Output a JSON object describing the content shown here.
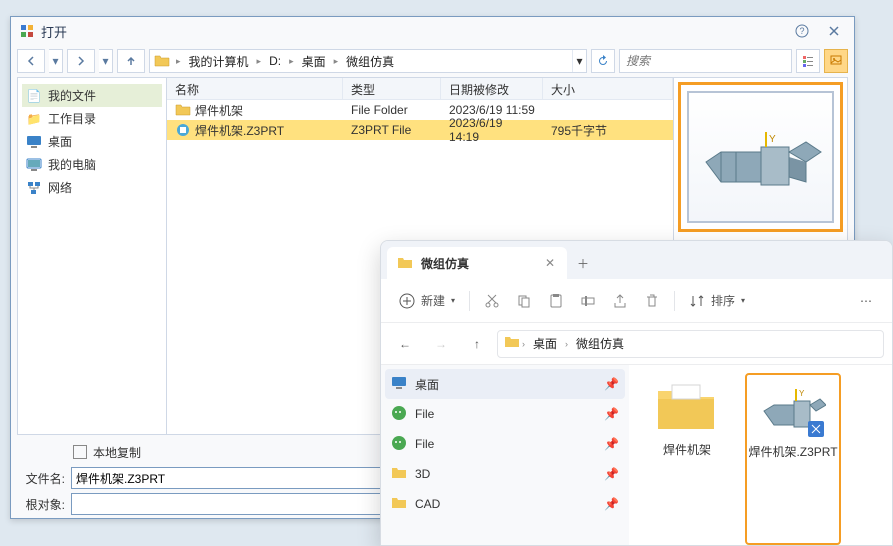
{
  "dialog": {
    "title": "打开",
    "breadcrumb": [
      "我的计算机",
      "D:",
      "桌面",
      "微组仿真"
    ],
    "search_placeholder": "搜索",
    "tree": [
      {
        "label": "我的文件",
        "icon": "file-icon"
      },
      {
        "label": "工作目录",
        "icon": "folder-link-icon"
      },
      {
        "label": "桌面",
        "icon": "desktop-icon"
      },
      {
        "label": "我的电脑",
        "icon": "monitor-icon"
      },
      {
        "label": "网络",
        "icon": "network-icon"
      }
    ],
    "columns": {
      "name": "名称",
      "type": "类型",
      "date": "日期被修改",
      "size": "大小"
    },
    "rows": [
      {
        "name": "焊件机架",
        "type": "File Folder",
        "date": "2023/6/19 11:59",
        "size": "",
        "icon": "folder"
      },
      {
        "name": "焊件机架.Z3PRT",
        "type": "Z3PRT File",
        "date": "2023/6/19 14:19",
        "size": "795千字节",
        "icon": "z3prt",
        "selected": true
      }
    ],
    "local_copy": "本地复制",
    "filename_label": "文件名:",
    "filename_value": "焊件机架.Z3PRT",
    "root_label": "根对象:"
  },
  "explorer": {
    "tab_title": "微组仿真",
    "new_label": "新建",
    "sort_label": "排序",
    "breadcrumb": [
      "桌面",
      "微组仿真"
    ],
    "side": [
      {
        "label": "桌面",
        "icon": "desktop",
        "selected": true
      },
      {
        "label": "File",
        "icon": "wechat"
      },
      {
        "label": "File",
        "icon": "wechat"
      },
      {
        "label": "3D",
        "icon": "folder"
      },
      {
        "label": "CAD",
        "icon": "folder"
      }
    ],
    "files": [
      {
        "name": "焊件机架",
        "icon": "folder",
        "selected": false
      },
      {
        "name": "焊件机架.Z3PRT",
        "icon": "part",
        "selected": true
      }
    ]
  }
}
